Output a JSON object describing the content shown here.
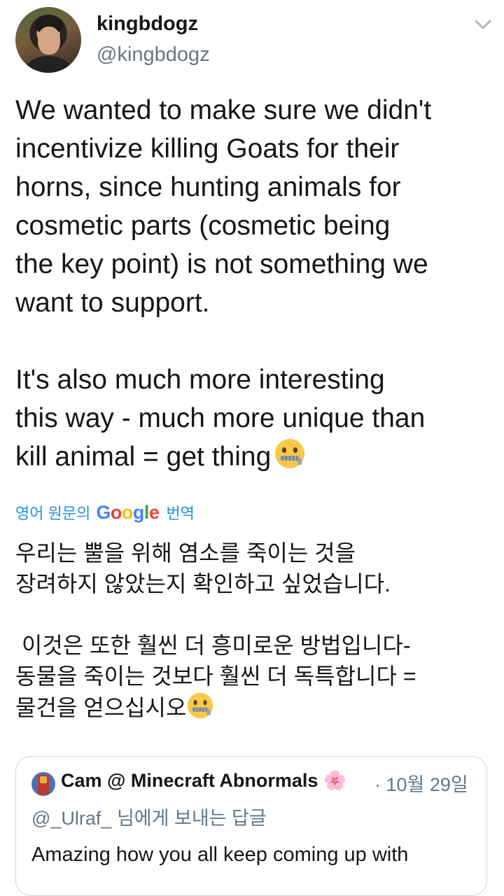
{
  "author": {
    "display_name": "kingbdogz",
    "handle": "@kingbdogz"
  },
  "menu_icon": "chevron-down-icon",
  "tweet": {
    "paragraph1": "We wanted to make sure we didn't\nincentivize killing Goats for their\nhorns, since hunting animals for\ncosmetic parts (cosmetic being\nthe key point) is not something we\nwant to support.",
    "paragraph2": "It's also much more interesting\nthis way - much more unique than\nkill animal = get thing",
    "emoji": "zipper-mouth-face-icon"
  },
  "translation": {
    "label": "영어 원문의",
    "provider_letters": [
      "G",
      "o",
      "o",
      "g",
      "l",
      "e"
    ],
    "action": "번역",
    "paragraph1": "우리는 뿔을 위해 염소를 죽이는 것을\n장려하지 않았는지 확인하고 싶었습니다.",
    "paragraph2": " 이것은 또한 훨씬 더 흥미로운 방법입니다-\n동물을 죽이는 것보다 훨씬 더 독특합니다 =\n물건을 얻으십시오"
  },
  "quoted_tweet": {
    "author_name": "Cam @ Minecraft Abnormals 🌸",
    "date": "· 10월 29일",
    "reply_handle": "@_Ulraf_",
    "reply_suffix": " 님에게 보내는 답글",
    "text": "Amazing how you all keep coming up with"
  },
  "colors": {
    "link": "#1b95e0",
    "secondary_text": "#657786",
    "border": "#ccd6dd"
  }
}
